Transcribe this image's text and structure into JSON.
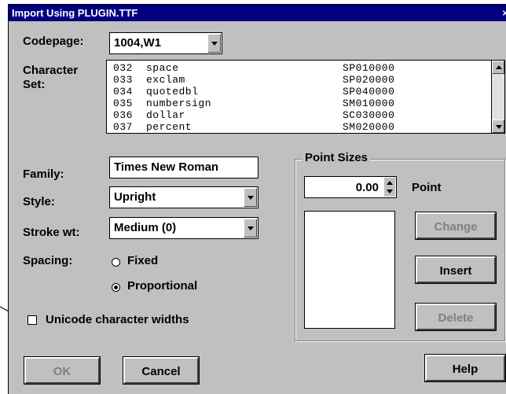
{
  "window": {
    "title": "Import Using PLUGIN.TTF",
    "close_glyph": "×"
  },
  "codepage": {
    "label": "Codepage:",
    "value": "1004,W1"
  },
  "charset": {
    "label_line1": "Character",
    "label_line2": "Set:",
    "rows": [
      [
        "032",
        "space",
        "SP010000"
      ],
      [
        "033",
        "exclam",
        "SP020000"
      ],
      [
        "034",
        "quotedbl",
        "SP040000"
      ],
      [
        "035",
        "numbersign",
        "SM010000"
      ],
      [
        "036",
        "dollar",
        "SC030000"
      ],
      [
        "037",
        "percent",
        "SM020000"
      ]
    ]
  },
  "family": {
    "label": "Family:",
    "value": "Times New Roman"
  },
  "style": {
    "label": "Style:",
    "value": "Upright"
  },
  "stroke": {
    "label": "Stroke wt:",
    "value": "Medium (0)"
  },
  "spacing": {
    "label": "Spacing:",
    "fixed": "Fixed",
    "proportional": "Proportional",
    "selected": "Proportional"
  },
  "unicode": {
    "label": "Unicode character widths",
    "checked": false
  },
  "point_sizes": {
    "title": "Point Sizes",
    "value": "0.00",
    "unit_label": "Point"
  },
  "buttons": {
    "change": "Change",
    "insert": "Insert",
    "delete": "Delete",
    "ok": "OK",
    "cancel": "Cancel",
    "help": "Help"
  },
  "colors": {
    "titlebar": "#000080",
    "face": "#c0c0c0",
    "disabled_text": "#808080"
  }
}
